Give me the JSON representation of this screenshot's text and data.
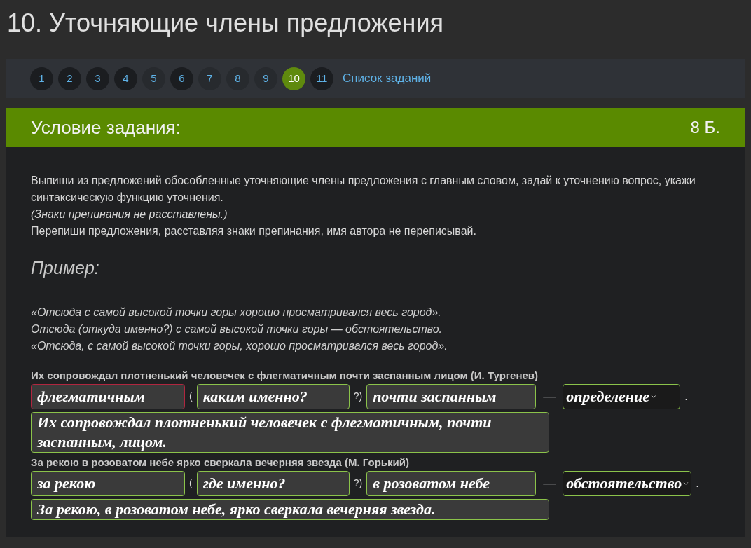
{
  "page_title": "10. Уточняющие члены предложения",
  "pagination": {
    "pages": [
      {
        "label": "1",
        "done": true,
        "selected": false
      },
      {
        "label": "2",
        "done": true,
        "selected": false
      },
      {
        "label": "3",
        "done": true,
        "selected": false
      },
      {
        "label": "4",
        "done": true,
        "selected": false
      },
      {
        "label": "5",
        "done": false,
        "selected": false
      },
      {
        "label": "6",
        "done": true,
        "selected": false
      },
      {
        "label": "7",
        "done": false,
        "selected": false
      },
      {
        "label": "8",
        "done": false,
        "selected": false
      },
      {
        "label": "9",
        "done": false,
        "selected": false
      },
      {
        "label": "10",
        "done": false,
        "selected": true
      },
      {
        "label": "11",
        "done": true,
        "selected": false
      }
    ],
    "list_link": "Список заданий"
  },
  "task": {
    "header": "Условие задания:",
    "points": "8 Б.",
    "instructions": [
      "Выпиши из предложений обособленные уточняющие члены предложения с главным словом, задай к уточнению вопрос, укажи синтаксическую функцию уточнения.",
      "(Знаки препинания не расставлены.)",
      "Перепиши предложения, расставляя знаки препинания, имя автора не переписывай."
    ],
    "example_heading": "Пример:",
    "example_lines": [
      "«Отсюда с самой высокой точки горы хорошо просматривался весь город».",
      "Отсюда (откуда именно?) с самой высокой точки горы — обстоятельство.",
      "«Отсюда, с самой высокой точки горы, хорошо просматривался весь город»."
    ],
    "exercises": [
      {
        "sentence": "Их сопровождал плотненький человечек с флегматичным почти заспанным лицом (И. Тургенев)",
        "main_word": {
          "value": "флегматичным",
          "correct": false
        },
        "open_paren": "(",
        "question": {
          "value": "каким именно?",
          "correct": true
        },
        "close_paren": "?)",
        "clarification": {
          "value": "почти заспанным",
          "correct": true
        },
        "dash": "—",
        "function": {
          "value": "определение",
          "correct": true
        },
        "period": ".",
        "rewrite": {
          "value": "Их сопровождал плотненький человечек с флегматичным, почти заспанным, лицом.",
          "correct": true
        }
      },
      {
        "sentence": "За рекою в розоватом небе ярко сверкала вечерняя звезда (М. Горький)",
        "main_word": {
          "value": "за рекою",
          "correct": true
        },
        "open_paren": "(",
        "question": {
          "value": "где именно?",
          "correct": true
        },
        "close_paren": "?)",
        "clarification": {
          "value": "в розоватом небе",
          "correct": true
        },
        "dash": "—",
        "function": {
          "value": "обстоятельство",
          "correct": true
        },
        "period": ".",
        "rewrite": {
          "value": "За рекою, в розоватом небе, ярко сверкала вечерняя звезда.",
          "correct": true
        }
      }
    ]
  }
}
